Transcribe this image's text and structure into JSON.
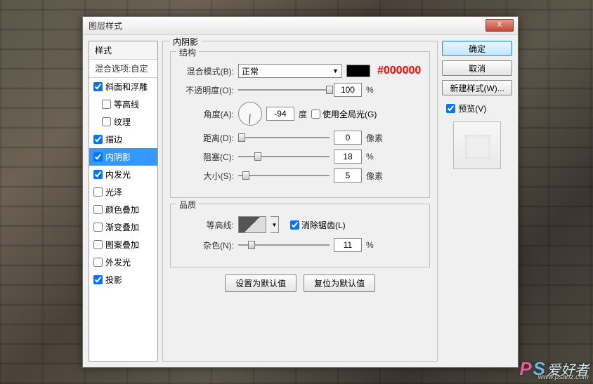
{
  "window": {
    "title": "图层样式"
  },
  "close_x": "X",
  "styles": {
    "header": "样式",
    "blend_defaults": "混合选项:自定",
    "items": [
      {
        "label": "斜面和浮雕",
        "checked": true,
        "indent": false
      },
      {
        "label": "等高线",
        "checked": false,
        "indent": true
      },
      {
        "label": "纹理",
        "checked": false,
        "indent": true
      },
      {
        "label": "描边",
        "checked": true,
        "indent": false
      },
      {
        "label": "内阴影",
        "checked": true,
        "indent": false,
        "selected": true
      },
      {
        "label": "内发光",
        "checked": true,
        "indent": false
      },
      {
        "label": "光泽",
        "checked": false,
        "indent": false
      },
      {
        "label": "颜色叠加",
        "checked": false,
        "indent": false
      },
      {
        "label": "渐变叠加",
        "checked": false,
        "indent": false
      },
      {
        "label": "图案叠加",
        "checked": false,
        "indent": false
      },
      {
        "label": "外发光",
        "checked": false,
        "indent": false
      },
      {
        "label": "投影",
        "checked": true,
        "indent": false
      }
    ]
  },
  "panel": {
    "title": "内阴影",
    "structure": {
      "legend": "结构",
      "blend_mode_label": "混合模式(B):",
      "blend_mode_value": "正常",
      "color_hex": "#000000",
      "opacity_label": "不透明度(O):",
      "opacity_value": "100",
      "opacity_unit": "%",
      "angle_label": "角度(A):",
      "angle_value": "-94",
      "angle_unit": "度",
      "global_light_label": "使用全局光(G)",
      "global_light_checked": false,
      "distance_label": "距离(D):",
      "distance_value": "0",
      "distance_unit": "像素",
      "choke_label": "阻塞(C):",
      "choke_value": "18",
      "choke_unit": "%",
      "size_label": "大小(S):",
      "size_value": "5",
      "size_unit": "像素"
    },
    "quality": {
      "legend": "品质",
      "contour_label": "等高线:",
      "antialias_label": "消除锯齿(L)",
      "antialias_checked": true,
      "noise_label": "杂色(N):",
      "noise_value": "11",
      "noise_unit": "%"
    },
    "buttons": {
      "default": "设置为默认值",
      "reset": "复位为默认值"
    }
  },
  "right": {
    "ok": "确定",
    "cancel": "取消",
    "new_style": "新建样式(W)...",
    "preview_label": "预览(V)",
    "preview_checked": true
  },
  "watermark": {
    "p": "P",
    "s": "S",
    "cn": "爱好者",
    "url": "www.psahz.com"
  }
}
